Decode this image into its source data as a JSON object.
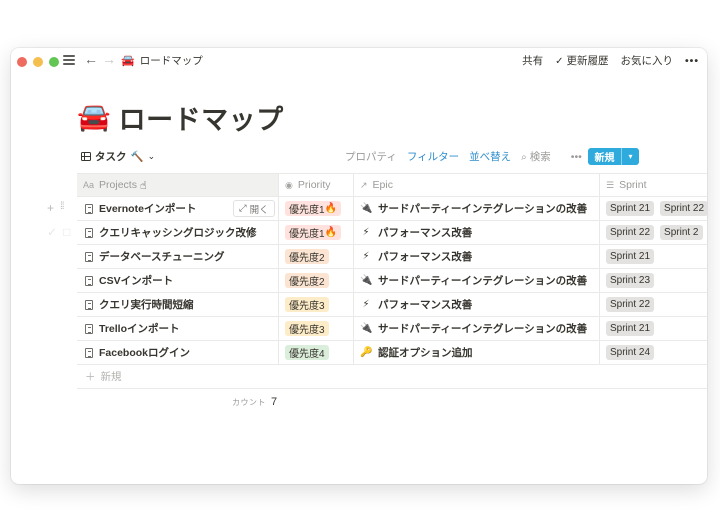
{
  "topbar": {
    "breadcrumb_icon": "car-emoji",
    "breadcrumb": "ロードマップ",
    "share": "共有",
    "updates": "更新履歴",
    "favorite": "お気に入り",
    "more": "•••"
  },
  "page": {
    "icon": "🚘",
    "title": "ロードマップ"
  },
  "view": {
    "name": "タスク",
    "name_icon": "🔨",
    "properties": "プロパティ",
    "filter": "フィルター",
    "sort": "並べ替え",
    "search": "検索",
    "more": "•••",
    "new": "新規"
  },
  "columns": [
    {
      "label": "Projects",
      "icon": "Aa"
    },
    {
      "label": "Priority",
      "icon": "select-icon"
    },
    {
      "label": "Epic",
      "icon": "relation-arrow-icon"
    },
    {
      "label": "Sprint",
      "icon": "list-icon"
    }
  ],
  "rows": [
    {
      "name": "Evernoteインポート",
      "priority": "優先度1",
      "priority_emoji": "🔥",
      "priority_color": "red",
      "epic_emoji": "🔌",
      "epic": "サードパーティーインテグレーションの改善",
      "sprints": [
        "Sprint 21",
        "Sprint 22"
      ]
    },
    {
      "name": "クエリキャッシングロジック改修",
      "priority": "優先度1",
      "priority_emoji": "🔥",
      "priority_color": "red",
      "epic_emoji": "⚡",
      "epic": "パフォーマンス改善",
      "sprints": [
        "Sprint 22",
        "Sprint 2"
      ]
    },
    {
      "name": "データベースチューニング",
      "priority": "優先度2",
      "priority_emoji": "",
      "priority_color": "orange",
      "epic_emoji": "⚡",
      "epic": "パフォーマンス改善",
      "sprints": [
        "Sprint 21"
      ]
    },
    {
      "name": "CSVインポート",
      "priority": "優先度2",
      "priority_emoji": "",
      "priority_color": "orange",
      "epic_emoji": "🔌",
      "epic": "サードパーティーインテグレーションの改善",
      "sprints": [
        "Sprint 23"
      ]
    },
    {
      "name": "クエリ実行時間短縮",
      "priority": "優先度3",
      "priority_emoji": "",
      "priority_color": "yellow",
      "epic_emoji": "⚡",
      "epic": "パフォーマンス改善",
      "sprints": [
        "Sprint 22"
      ]
    },
    {
      "name": "Trelloインポート",
      "priority": "優先度3",
      "priority_emoji": "",
      "priority_color": "yellow",
      "epic_emoji": "🔌",
      "epic": "サードパーティーインテグレーションの改善",
      "sprints": [
        "Sprint 21"
      ]
    },
    {
      "name": "Facebookログイン",
      "priority": "優先度4",
      "priority_emoji": "",
      "priority_color": "green",
      "epic_emoji": "🔑",
      "epic": "認証オプション追加",
      "sprints": [
        "Sprint 24"
      ]
    }
  ],
  "open_button": "開く",
  "new_row": "新規",
  "count_label": "カウント",
  "count_value": "7",
  "colors": {
    "accent": "#2eaadc",
    "link": "#2f8ecd",
    "priority_red": "#ffe2dd",
    "priority_orange": "#fbe4d1",
    "priority_yellow": "#fdecc8",
    "priority_green": "#dbeddb",
    "sprint_gray": "#e3e2e0"
  }
}
